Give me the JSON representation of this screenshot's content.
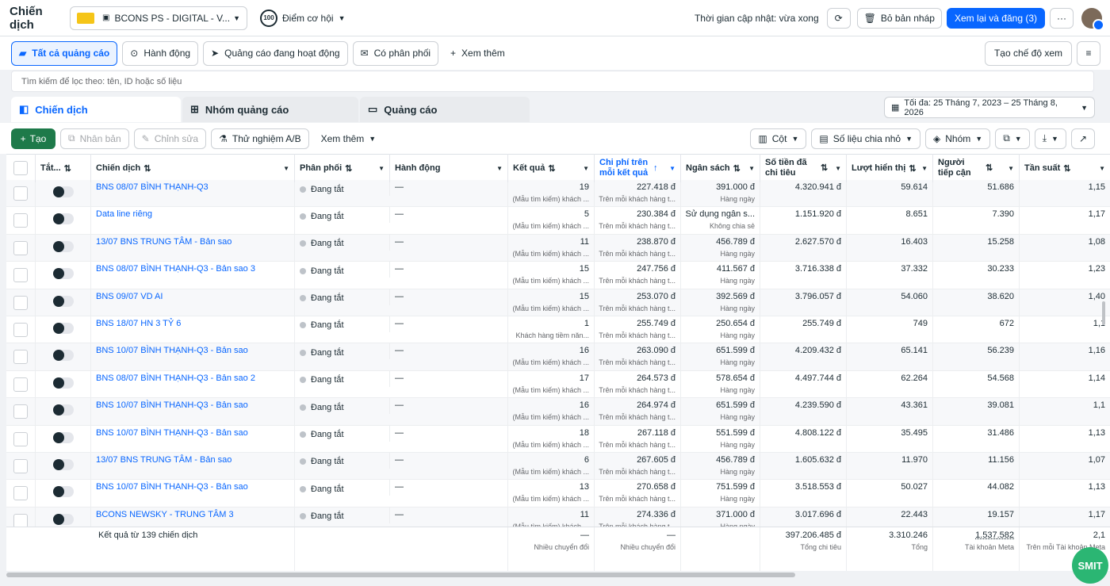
{
  "topbar": {
    "title": "Chiến dịch",
    "account_name": "BCONS PS - DIGITAL - V...",
    "score_badge": "100",
    "score_label": "Điểm cơ hội",
    "updated": "Thời gian cập nhật: vừa xong",
    "discard": "Bỏ bản nháp",
    "publish": "Xem lại và đăng (3)",
    "more": "···"
  },
  "filters": {
    "chips": [
      "Tất cả quảng cáo",
      "Hành động",
      "Quảng cáo đang hoạt động",
      "Có phân phối"
    ],
    "more": "Xem thêm",
    "create_view": "Tạo chế độ xem"
  },
  "search": {
    "placeholder": "Tìm kiếm để lọc theo: tên, ID hoặc số liệu"
  },
  "tabs": [
    "Chiến dịch",
    "Nhóm quảng cáo",
    "Quảng cáo"
  ],
  "date_range": "Tối đa: 25 Tháng 7, 2023 – 25 Tháng 8, 2026",
  "toolbar": {
    "create": "Tạo",
    "duplicate": "Nhân bản",
    "edit": "Chỉnh sửa",
    "ab": "Thử nghiệm A/B",
    "more": "Xem thêm",
    "columns": "Cột",
    "breakdown": "Số liệu chia nhỏ",
    "group": "Nhóm"
  },
  "columns": [
    "Tắt...",
    "Chiến dịch",
    "Phân phối",
    "Hành động",
    "Kết quả",
    "Chi phí trên mỗi kết quả",
    "Ngân sách",
    "Số tiền đã chi tiêu",
    "Lượt hiển thị",
    "Người tiếp cận",
    "Tần suất"
  ],
  "rows": [
    {
      "name": "BNS 08/07 BÌNH THẠNH-Q3",
      "status": "Đang tắt",
      "action": "—",
      "result": "19",
      "result_sub": "(Mẫu tìm kiếm) khách ...",
      "cost": "227.418 đ",
      "cost_sub": "Trên mỗi khách hàng t...",
      "budget": "391.000 đ",
      "budget_sub": "Hàng ngày",
      "spent": "4.320.941 đ",
      "impr": "59.614",
      "reach": "51.686",
      "freq": "1,15"
    },
    {
      "name": "Data line riêng",
      "status": "Đang tắt",
      "action": "—",
      "result": "5",
      "result_sub": "(Mẫu tìm kiếm) khách ...",
      "cost": "230.384 đ",
      "cost_sub": "Trên mỗi khách hàng t...",
      "budget": "Sử dụng ngân s...",
      "budget_sub": "Không chia sẻ",
      "spent": "1.151.920 đ",
      "impr": "8.651",
      "reach": "7.390",
      "freq": "1,17"
    },
    {
      "name": "13/07 BNS TRUNG TÂM - Bản sao",
      "status": "Đang tắt",
      "action": "—",
      "result": "11",
      "result_sub": "(Mẫu tìm kiếm) khách ...",
      "cost": "238.870 đ",
      "cost_sub": "Trên mỗi khách hàng t...",
      "budget": "456.789 đ",
      "budget_sub": "Hàng ngày",
      "spent": "2.627.570 đ",
      "impr": "16.403",
      "reach": "15.258",
      "freq": "1,08"
    },
    {
      "name": "BNS 08/07 BÌNH THẠNH-Q3 - Bản sao 3",
      "status": "Đang tắt",
      "action": "—",
      "result": "15",
      "result_sub": "(Mẫu tìm kiếm) khách ...",
      "cost": "247.756 đ",
      "cost_sub": "Trên mỗi khách hàng t...",
      "budget": "411.567 đ",
      "budget_sub": "Hàng ngày",
      "spent": "3.716.338 đ",
      "impr": "37.332",
      "reach": "30.233",
      "freq": "1,23"
    },
    {
      "name": "BNS 09/07 VD AI",
      "status": "Đang tắt",
      "action": "—",
      "result": "15",
      "result_sub": "(Mẫu tìm kiếm) khách ...",
      "cost": "253.070 đ",
      "cost_sub": "Trên mỗi khách hàng t...",
      "budget": "392.569 đ",
      "budget_sub": "Hàng ngày",
      "spent": "3.796.057 đ",
      "impr": "54.060",
      "reach": "38.620",
      "freq": "1,40"
    },
    {
      "name": "BNS 18/07 HN 3 TỶ 6",
      "status": "Đang tắt",
      "action": "—",
      "result": "1",
      "result_sub": "Khách hàng tiềm năn...",
      "cost": "255.749 đ",
      "cost_sub": "Trên mỗi khách hàng t...",
      "budget": "250.654 đ",
      "budget_sub": "Hàng ngày",
      "spent": "255.749 đ",
      "impr": "749",
      "reach": "672",
      "freq": "1,1"
    },
    {
      "name": "BNS 10/07 BÌNH THẠNH-Q3 - Bản sao",
      "status": "Đang tắt",
      "action": "—",
      "result": "16",
      "result_sub": "(Mẫu tìm kiếm) khách ...",
      "cost": "263.090 đ",
      "cost_sub": "Trên mỗi khách hàng t...",
      "budget": "651.599 đ",
      "budget_sub": "Hàng ngày",
      "spent": "4.209.432 đ",
      "impr": "65.141",
      "reach": "56.239",
      "freq": "1,16"
    },
    {
      "name": "BNS 08/07 BÌNH THẠNH-Q3 - Bản sao 2",
      "status": "Đang tắt",
      "action": "—",
      "result": "17",
      "result_sub": "(Mẫu tìm kiếm) khách ...",
      "cost": "264.573 đ",
      "cost_sub": "Trên mỗi khách hàng t...",
      "budget": "578.654 đ",
      "budget_sub": "Hàng ngày",
      "spent": "4.497.744 đ",
      "impr": "62.264",
      "reach": "54.568",
      "freq": "1,14"
    },
    {
      "name": "BNS 10/07 BÌNH THẠNH-Q3 - Bản sao",
      "status": "Đang tắt",
      "action": "—",
      "result": "16",
      "result_sub": "(Mẫu tìm kiếm) khách ...",
      "cost": "264.974 đ",
      "cost_sub": "Trên mỗi khách hàng t...",
      "budget": "651.599 đ",
      "budget_sub": "Hàng ngày",
      "spent": "4.239.590 đ",
      "impr": "43.361",
      "reach": "39.081",
      "freq": "1,1"
    },
    {
      "name": "BNS 10/07 BÌNH THẠNH-Q3 - Bản sao",
      "status": "Đang tắt",
      "action": "—",
      "result": "18",
      "result_sub": "(Mẫu tìm kiếm) khách ...",
      "cost": "267.118 đ",
      "cost_sub": "Trên mỗi khách hàng t...",
      "budget": "551.599 đ",
      "budget_sub": "Hàng ngày",
      "spent": "4.808.122 đ",
      "impr": "35.495",
      "reach": "31.486",
      "freq": "1,13"
    },
    {
      "name": "13/07 BNS TRUNG TÂM - Bản sao",
      "status": "Đang tắt",
      "action": "—",
      "result": "6",
      "result_sub": "(Mẫu tìm kiếm) khách ...",
      "cost": "267.605 đ",
      "cost_sub": "Trên mỗi khách hàng t...",
      "budget": "456.789 đ",
      "budget_sub": "Hàng ngày",
      "spent": "1.605.632 đ",
      "impr": "11.970",
      "reach": "11.156",
      "freq": "1,07"
    },
    {
      "name": "BNS 10/07 BÌNH THẠNH-Q3 - Bản sao",
      "status": "Đang tắt",
      "action": "—",
      "result": "13",
      "result_sub": "(Mẫu tìm kiếm) khách ...",
      "cost": "270.658 đ",
      "cost_sub": "Trên mỗi khách hàng t...",
      "budget": "751.599 đ",
      "budget_sub": "Hàng ngày",
      "spent": "3.518.553 đ",
      "impr": "50.027",
      "reach": "44.082",
      "freq": "1,13"
    },
    {
      "name": "BCONS NEWSKY - TRUNG TÂM 3",
      "status": "Đang tắt",
      "action": "—",
      "result": "11",
      "result_sub": "(Mẫu tìm kiếm) khách ...",
      "cost": "274.336 đ",
      "cost_sub": "Trên mỗi khách hàng t...",
      "budget": "371.000 đ",
      "budget_sub": "Hàng ngày",
      "spent": "3.017.696 đ",
      "impr": "22.443",
      "reach": "19.157",
      "freq": "1,17"
    }
  ],
  "footer": {
    "label": "Kết quả từ 139 chiến dịch",
    "result": "—",
    "result_sub": "Nhiều chuyển đổi",
    "cost": "—",
    "cost_sub": "Nhiều chuyển đổi",
    "spent": "397.206.485 đ",
    "spent_sub": "Tổng chi tiêu",
    "impr": "3.310.246",
    "impr_sub": "Tổng",
    "reach": "1.537.582",
    "reach_sub": "Tài khoản Meta",
    "freq": "2,1",
    "freq_sub": "Trên mỗi Tài khoản Meta"
  },
  "smit": "SMIT"
}
